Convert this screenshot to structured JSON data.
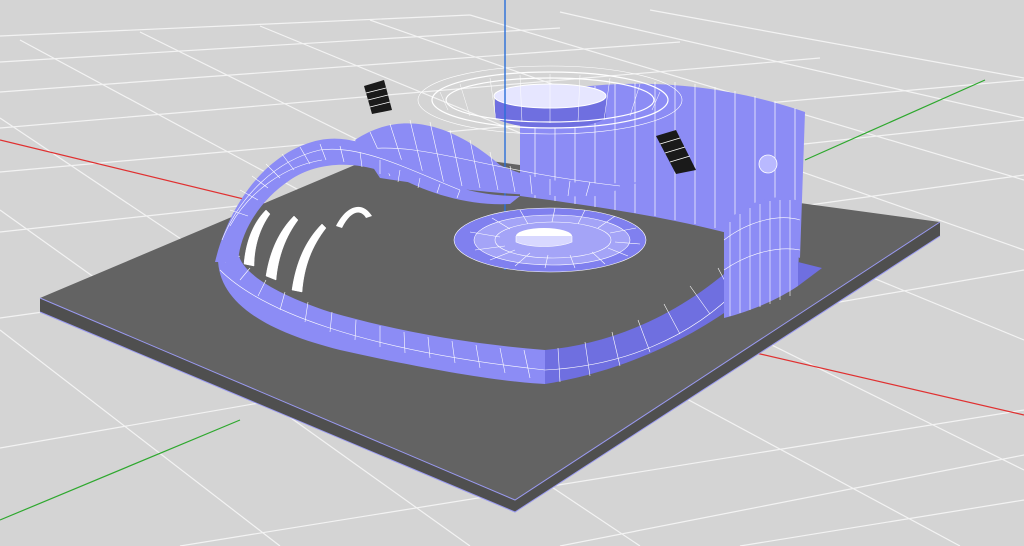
{
  "viewport": {
    "background": "#d4d4d4",
    "grid_color": "#f3f3f3",
    "axis_colors": {
      "x": "#e03030",
      "y": "#2ea82e",
      "z": "#2a6fd9"
    }
  },
  "model": {
    "base_plate_color": "#636363",
    "base_plate_edge_color": "#4f4f4f",
    "shell_color": "#8c8cf5",
    "shell_dark_color": "#6f6fe0",
    "wireframe_color": "#ffffff",
    "speaker_color": "#1a1a1a"
  }
}
